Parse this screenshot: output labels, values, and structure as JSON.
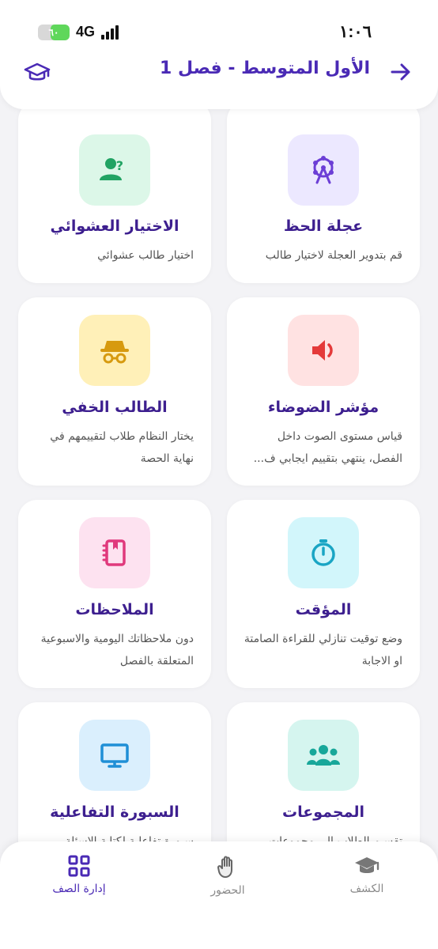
{
  "status_bar": {
    "time": "١:٠٦",
    "network": "4G",
    "battery_label": "٦٠",
    "battery_level": 0.6
  },
  "header": {
    "title": "الأول المتوسط - فصل 1",
    "back_icon": "arrow-right-icon",
    "action_icon": "graduation-cap-icon"
  },
  "cards": [
    {
      "title": "عجلة الحظ",
      "desc": "قم بتدوير العجلة لاختيار طالب",
      "icon": "ferris-wheel-icon",
      "bg": "#ece8ff",
      "color": "#6c3fd6"
    },
    {
      "title": "الاختيار العشوائي",
      "desc": "اختيار طالب عشوائي",
      "icon": "user-question-icon",
      "bg": "#dcf7e8",
      "color": "#21a363"
    },
    {
      "title": "مؤشر الضوضاء",
      "desc": "قياس مستوى الصوت داخل الفصل، ينتهي بتقييم ايجابي ف...",
      "icon": "speaker-icon",
      "bg": "#ffe2e2",
      "color": "#e43a3a"
    },
    {
      "title": "الطالب الخفي",
      "desc": "يختار النظام طلاب لتقييمهم في نهاية الحصة",
      "icon": "incognito-icon",
      "bg": "#fff0b8",
      "color": "#d79a0f"
    },
    {
      "title": "المؤقت",
      "desc": "وضع توقيت تنازلي للقراءة الصامتة او الاجابة",
      "icon": "stopwatch-icon",
      "bg": "#d2f6fb",
      "color": "#1aa5c4"
    },
    {
      "title": "الملاحظات",
      "desc": "دون ملاحظاتك اليومية والاسبوعية المتعلقة بالفصل",
      "icon": "notebook-icon",
      "bg": "#fde2f0",
      "color": "#e0397c"
    },
    {
      "title": "المجموعات",
      "desc": "تقسيم الطلاب الى مجموعات",
      "icon": "users-group-icon",
      "bg": "#d5f5ef",
      "color": "#18a79a"
    },
    {
      "title": "السبورة التفاعلية",
      "desc": "سبورة تفاعلية لكتابة الاسئلة",
      "icon": "monitor-icon",
      "bg": "#daeffd",
      "color": "#1f8fd6"
    }
  ],
  "bottom_nav": {
    "items": [
      {
        "label": "إدارة الصف",
        "icon": "grid-icon",
        "active": true
      },
      {
        "label": "الحضور",
        "icon": "hand-icon",
        "active": false
      },
      {
        "label": "الكشف",
        "icon": "graduation-cap-icon",
        "active": false
      }
    ]
  },
  "colors": {
    "brand": "#4a2ab5",
    "title": "#3d1f8f",
    "background": "#f3f3f6"
  }
}
